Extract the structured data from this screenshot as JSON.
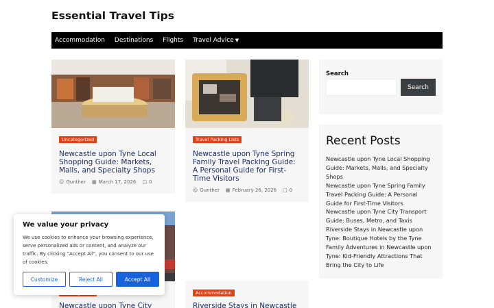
{
  "site": {
    "title": "Essential Travel Tips"
  },
  "nav": {
    "items": [
      "Accommodation",
      "Destinations",
      "Flights",
      "Travel Advice"
    ]
  },
  "posts": [
    {
      "category": "Uncategorized",
      "title": "Newcastle upon Tyne Local Shopping Guide: Markets, Malls, and Specialty Shops",
      "author": "Gunther",
      "date": "March 17, 2026",
      "comments": "0"
    },
    {
      "category": "Travel Packing Lists",
      "title": "Newcastle upon Tyne Spring Family Travel Packing Guide: A Personal Guide for First-Time Visitors",
      "author": "Gunther",
      "date": "February 26, 2026",
      "comments": "0"
    },
    {
      "category": "Uncategorized",
      "title": "Newcastle upon Tyne City"
    },
    {
      "category": "Accommodation",
      "title": "Riverside Stays in Newcastle"
    }
  ],
  "sidebar": {
    "search_label": "Search",
    "search_button": "Search",
    "recent_title": "Recent Posts",
    "recent_posts": [
      "Newcastle upon Tyne Local Shopping Guide: Markets, Malls, and Specialty Shops",
      "Newcastle upon Tyne Spring Family Travel Packing Guide: A Personal Guide for First-Time Visitors",
      "Newcastle upon Tyne City Transport Guide: Buses, Metro, and Taxis",
      "Riverside Stays in Newcastle upon Tyne: Boutique Hotels by the Tyne",
      "Family Adventures in Newcastle upon Tyne: Kid-Friendly Attractions That Bring the City to Life"
    ]
  },
  "cookie": {
    "title": "We value your privacy",
    "text": "We use cookies to enhance your browsing experience, serve personalized ads or content, and analyze our traffic. By clicking \"Accept All\", you consent to our use of cookies.",
    "customize": "Customize",
    "reject": "Reject All",
    "accept": "Accept All"
  },
  "colors": {
    "category_badge": "#e0421a",
    "nav_bg": "#000000",
    "accent_blue": "#1863dc",
    "search_button": "#3a3f44"
  },
  "icons": [
    "user-icon",
    "calendar-icon",
    "comment-icon",
    "chevron-down-icon"
  ]
}
